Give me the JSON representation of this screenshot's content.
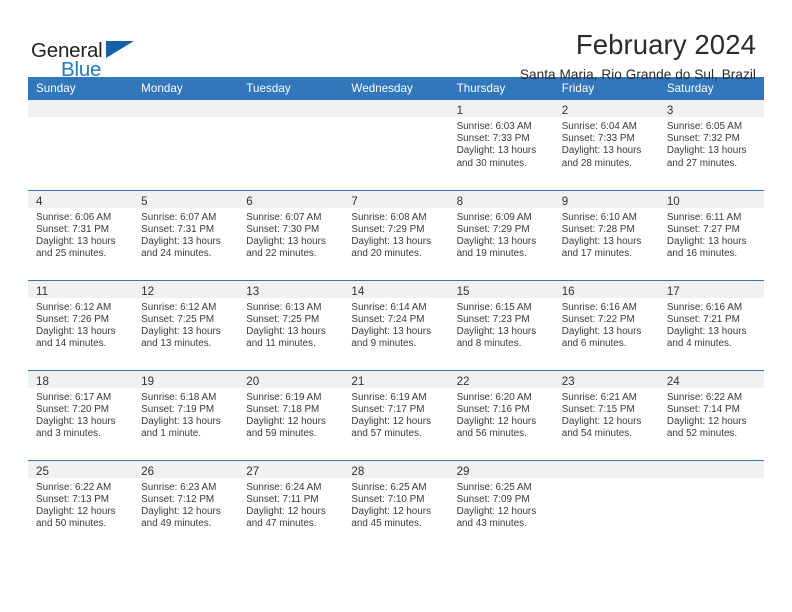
{
  "brand": {
    "name_top": "General",
    "name_bottom": "Blue",
    "accent_color": "#1461a8",
    "blue_text_color": "#1f7dc4",
    "triangle_icon": "brand-triangle-icon"
  },
  "header": {
    "title": "February 2024",
    "location": "Santa Maria, Rio Grande do Sul, Brazil"
  },
  "theme": {
    "header_row_bg": "#3277bc",
    "header_row_text": "#ffffff",
    "daynum_band_bg": "#f1f1f1",
    "row_separator": "#3277bc"
  },
  "weekdays": [
    "Sunday",
    "Monday",
    "Tuesday",
    "Wednesday",
    "Thursday",
    "Friday",
    "Saturday"
  ],
  "weeks": [
    [
      {
        "day": "",
        "sunrise": "",
        "sunset": "",
        "daylight_1": "",
        "daylight_2": "",
        "empty": true
      },
      {
        "day": "",
        "sunrise": "",
        "sunset": "",
        "daylight_1": "",
        "daylight_2": "",
        "empty": true
      },
      {
        "day": "",
        "sunrise": "",
        "sunset": "",
        "daylight_1": "",
        "daylight_2": "",
        "empty": true
      },
      {
        "day": "",
        "sunrise": "",
        "sunset": "",
        "daylight_1": "",
        "daylight_2": "",
        "empty": true
      },
      {
        "day": "1",
        "sunrise": "Sunrise: 6:03 AM",
        "sunset": "Sunset: 7:33 PM",
        "daylight_1": "Daylight: 13 hours",
        "daylight_2": "and 30 minutes."
      },
      {
        "day": "2",
        "sunrise": "Sunrise: 6:04 AM",
        "sunset": "Sunset: 7:33 PM",
        "daylight_1": "Daylight: 13 hours",
        "daylight_2": "and 28 minutes."
      },
      {
        "day": "3",
        "sunrise": "Sunrise: 6:05 AM",
        "sunset": "Sunset: 7:32 PM",
        "daylight_1": "Daylight: 13 hours",
        "daylight_2": "and 27 minutes."
      }
    ],
    [
      {
        "day": "4",
        "sunrise": "Sunrise: 6:06 AM",
        "sunset": "Sunset: 7:31 PM",
        "daylight_1": "Daylight: 13 hours",
        "daylight_2": "and 25 minutes."
      },
      {
        "day": "5",
        "sunrise": "Sunrise: 6:07 AM",
        "sunset": "Sunset: 7:31 PM",
        "daylight_1": "Daylight: 13 hours",
        "daylight_2": "and 24 minutes."
      },
      {
        "day": "6",
        "sunrise": "Sunrise: 6:07 AM",
        "sunset": "Sunset: 7:30 PM",
        "daylight_1": "Daylight: 13 hours",
        "daylight_2": "and 22 minutes."
      },
      {
        "day": "7",
        "sunrise": "Sunrise: 6:08 AM",
        "sunset": "Sunset: 7:29 PM",
        "daylight_1": "Daylight: 13 hours",
        "daylight_2": "and 20 minutes."
      },
      {
        "day": "8",
        "sunrise": "Sunrise: 6:09 AM",
        "sunset": "Sunset: 7:29 PM",
        "daylight_1": "Daylight: 13 hours",
        "daylight_2": "and 19 minutes."
      },
      {
        "day": "9",
        "sunrise": "Sunrise: 6:10 AM",
        "sunset": "Sunset: 7:28 PM",
        "daylight_1": "Daylight: 13 hours",
        "daylight_2": "and 17 minutes."
      },
      {
        "day": "10",
        "sunrise": "Sunrise: 6:11 AM",
        "sunset": "Sunset: 7:27 PM",
        "daylight_1": "Daylight: 13 hours",
        "daylight_2": "and 16 minutes."
      }
    ],
    [
      {
        "day": "11",
        "sunrise": "Sunrise: 6:12 AM",
        "sunset": "Sunset: 7:26 PM",
        "daylight_1": "Daylight: 13 hours",
        "daylight_2": "and 14 minutes."
      },
      {
        "day": "12",
        "sunrise": "Sunrise: 6:12 AM",
        "sunset": "Sunset: 7:25 PM",
        "daylight_1": "Daylight: 13 hours",
        "daylight_2": "and 13 minutes."
      },
      {
        "day": "13",
        "sunrise": "Sunrise: 6:13 AM",
        "sunset": "Sunset: 7:25 PM",
        "daylight_1": "Daylight: 13 hours",
        "daylight_2": "and 11 minutes."
      },
      {
        "day": "14",
        "sunrise": "Sunrise: 6:14 AM",
        "sunset": "Sunset: 7:24 PM",
        "daylight_1": "Daylight: 13 hours",
        "daylight_2": "and 9 minutes."
      },
      {
        "day": "15",
        "sunrise": "Sunrise: 6:15 AM",
        "sunset": "Sunset: 7:23 PM",
        "daylight_1": "Daylight: 13 hours",
        "daylight_2": "and 8 minutes."
      },
      {
        "day": "16",
        "sunrise": "Sunrise: 6:16 AM",
        "sunset": "Sunset: 7:22 PM",
        "daylight_1": "Daylight: 13 hours",
        "daylight_2": "and 6 minutes."
      },
      {
        "day": "17",
        "sunrise": "Sunrise: 6:16 AM",
        "sunset": "Sunset: 7:21 PM",
        "daylight_1": "Daylight: 13 hours",
        "daylight_2": "and 4 minutes."
      }
    ],
    [
      {
        "day": "18",
        "sunrise": "Sunrise: 6:17 AM",
        "sunset": "Sunset: 7:20 PM",
        "daylight_1": "Daylight: 13 hours",
        "daylight_2": "and 3 minutes."
      },
      {
        "day": "19",
        "sunrise": "Sunrise: 6:18 AM",
        "sunset": "Sunset: 7:19 PM",
        "daylight_1": "Daylight: 13 hours",
        "daylight_2": "and 1 minute."
      },
      {
        "day": "20",
        "sunrise": "Sunrise: 6:19 AM",
        "sunset": "Sunset: 7:18 PM",
        "daylight_1": "Daylight: 12 hours",
        "daylight_2": "and 59 minutes."
      },
      {
        "day": "21",
        "sunrise": "Sunrise: 6:19 AM",
        "sunset": "Sunset: 7:17 PM",
        "daylight_1": "Daylight: 12 hours",
        "daylight_2": "and 57 minutes."
      },
      {
        "day": "22",
        "sunrise": "Sunrise: 6:20 AM",
        "sunset": "Sunset: 7:16 PM",
        "daylight_1": "Daylight: 12 hours",
        "daylight_2": "and 56 minutes."
      },
      {
        "day": "23",
        "sunrise": "Sunrise: 6:21 AM",
        "sunset": "Sunset: 7:15 PM",
        "daylight_1": "Daylight: 12 hours",
        "daylight_2": "and 54 minutes."
      },
      {
        "day": "24",
        "sunrise": "Sunrise: 6:22 AM",
        "sunset": "Sunset: 7:14 PM",
        "daylight_1": "Daylight: 12 hours",
        "daylight_2": "and 52 minutes."
      }
    ],
    [
      {
        "day": "25",
        "sunrise": "Sunrise: 6:22 AM",
        "sunset": "Sunset: 7:13 PM",
        "daylight_1": "Daylight: 12 hours",
        "daylight_2": "and 50 minutes."
      },
      {
        "day": "26",
        "sunrise": "Sunrise: 6:23 AM",
        "sunset": "Sunset: 7:12 PM",
        "daylight_1": "Daylight: 12 hours",
        "daylight_2": "and 49 minutes."
      },
      {
        "day": "27",
        "sunrise": "Sunrise: 6:24 AM",
        "sunset": "Sunset: 7:11 PM",
        "daylight_1": "Daylight: 12 hours",
        "daylight_2": "and 47 minutes."
      },
      {
        "day": "28",
        "sunrise": "Sunrise: 6:25 AM",
        "sunset": "Sunset: 7:10 PM",
        "daylight_1": "Daylight: 12 hours",
        "daylight_2": "and 45 minutes."
      },
      {
        "day": "29",
        "sunrise": "Sunrise: 6:25 AM",
        "sunset": "Sunset: 7:09 PM",
        "daylight_1": "Daylight: 12 hours",
        "daylight_2": "and 43 minutes."
      },
      {
        "day": "",
        "sunrise": "",
        "sunset": "",
        "daylight_1": "",
        "daylight_2": "",
        "empty": true
      },
      {
        "day": "",
        "sunrise": "",
        "sunset": "",
        "daylight_1": "",
        "daylight_2": "",
        "empty": true
      }
    ]
  ]
}
